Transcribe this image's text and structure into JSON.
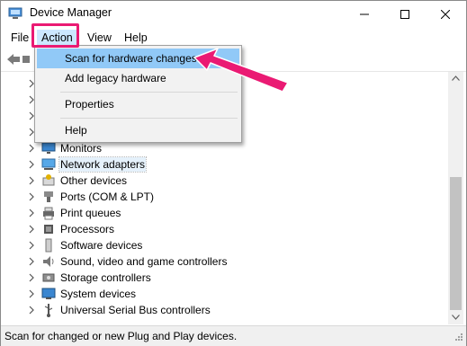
{
  "window": {
    "title": "Device Manager"
  },
  "menu": {
    "file": "File",
    "action": "Action",
    "view": "View",
    "help": "Help"
  },
  "dropdown": {
    "items": [
      {
        "label": "Scan for hardware changes",
        "highlighted": true
      },
      {
        "label": "Add legacy hardware",
        "highlighted": false
      },
      {
        "label": "Properties",
        "highlighted": false
      },
      {
        "label": "Help",
        "highlighted": false
      }
    ]
  },
  "tree": {
    "items": [
      {
        "label": "Monitors",
        "icon": "monitor-icon"
      },
      {
        "label": "Network adapters",
        "icon": "network-adapter-icon",
        "selected": true
      },
      {
        "label": "Other devices",
        "icon": "unknown-device-icon"
      },
      {
        "label": "Ports (COM & LPT)",
        "icon": "port-icon"
      },
      {
        "label": "Print queues",
        "icon": "printer-icon"
      },
      {
        "label": "Processors",
        "icon": "processor-icon"
      },
      {
        "label": "Software devices",
        "icon": "software-device-icon"
      },
      {
        "label": "Sound, video and game controllers",
        "icon": "speaker-icon"
      },
      {
        "label": "Storage controllers",
        "icon": "storage-controller-icon"
      },
      {
        "label": "System devices",
        "icon": "system-device-icon"
      },
      {
        "label": "Universal Serial Bus controllers",
        "icon": "usb-icon"
      }
    ]
  },
  "status": {
    "text": "Scan for changed or new Plug and Play devices."
  },
  "colors": {
    "annotation": "#ea1a73",
    "menu_highlight": "#91c9f7",
    "selection": "#e5f1fb"
  }
}
